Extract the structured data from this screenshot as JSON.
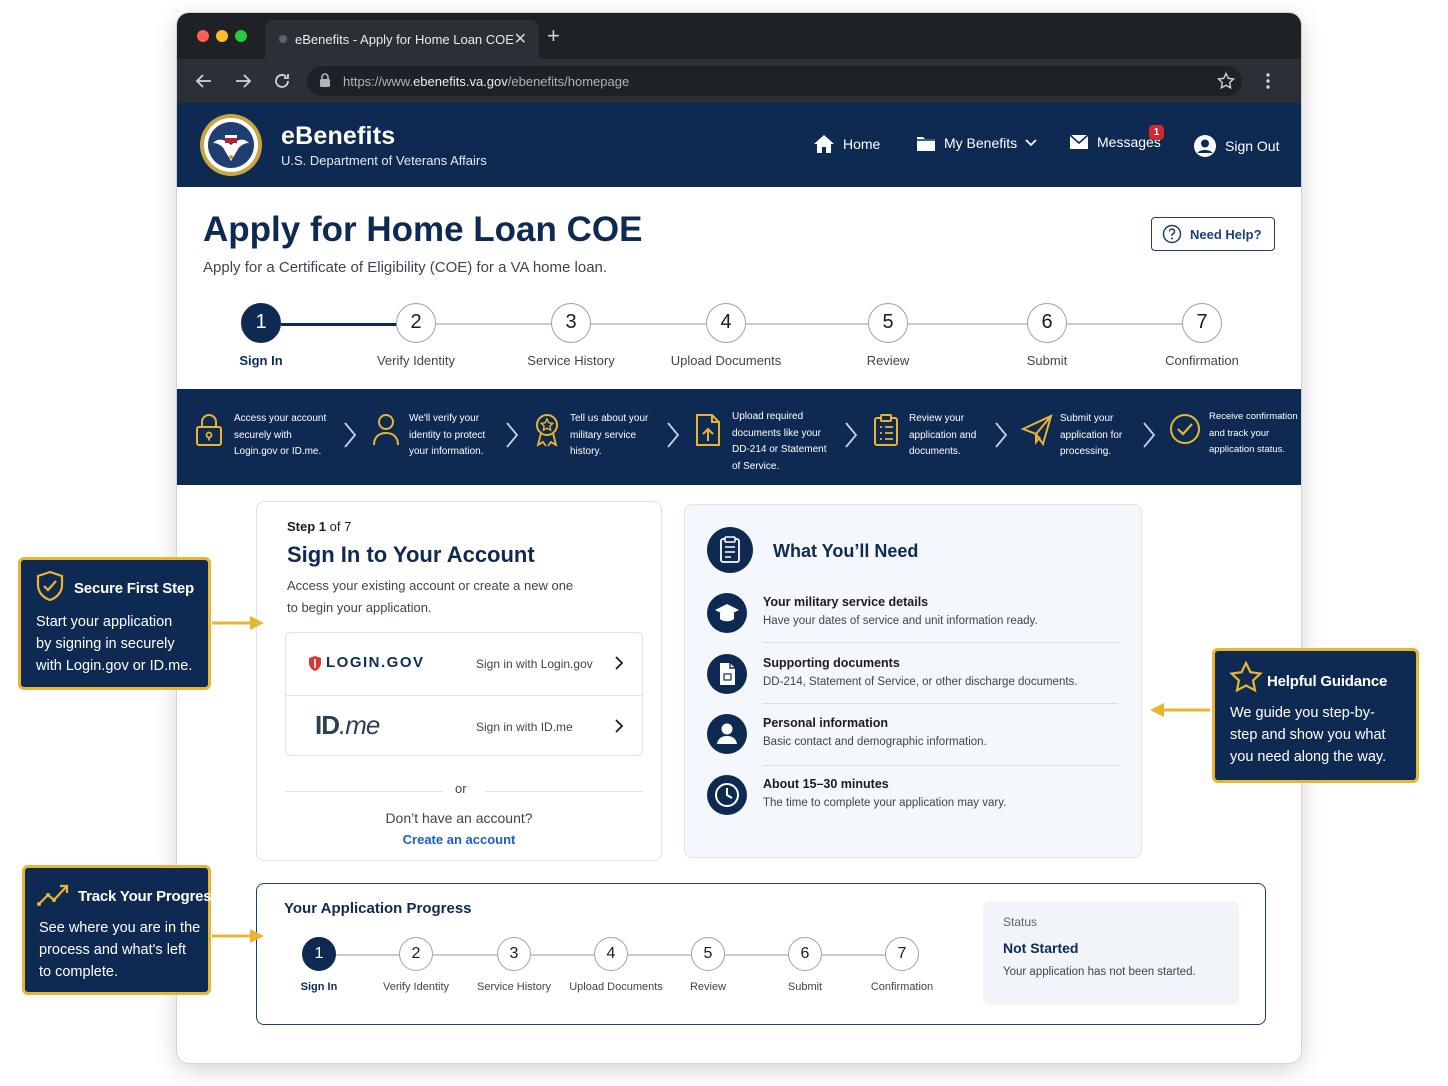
{
  "browser": {
    "tab_title": "eBenefits - Apply for Home Loan COE",
    "url_prefix": "https://www.",
    "url_domain": "ebenefits.va.gov",
    "url_path": "/ebenefits/homepage"
  },
  "header": {
    "brand": "eBenefits",
    "agency": "U.S. Department of Veterans Affairs",
    "nav": {
      "home": "Home",
      "my_benefits": "My Benefits",
      "messages": "Messages",
      "messages_badge": "1",
      "sign_out": "Sign Out"
    }
  },
  "page": {
    "title": "Apply for Home Loan COE",
    "subtitle": "Apply for a Certificate of Eligibility (COE) for a VA home loan.",
    "help_button": "Need Help?"
  },
  "steps": [
    {
      "num": "1",
      "label": "Sign In",
      "active": true
    },
    {
      "num": "2",
      "label": "Verify Identity",
      "active": false
    },
    {
      "num": "3",
      "label": "Service History",
      "active": false
    },
    {
      "num": "4",
      "label": "Upload Documents",
      "active": false
    },
    {
      "num": "5",
      "label": "Review",
      "active": false
    },
    {
      "num": "6",
      "label": "Submit",
      "active": false
    },
    {
      "num": "7",
      "label": "Confirmation",
      "active": false
    }
  ],
  "banner": [
    {
      "icon": "lock-icon",
      "lines": [
        "Access your account",
        "securely with",
        "Login.gov or ID.me."
      ]
    },
    {
      "icon": "person-icon",
      "lines": [
        "We'll verify your",
        "identity to protect",
        "your information."
      ]
    },
    {
      "icon": "medal-icon",
      "lines": [
        "Tell us about your",
        "military service",
        "history."
      ]
    },
    {
      "icon": "upload-document-icon",
      "lines": [
        "Upload required",
        "documents like your",
        "DD-214 or Statement",
        "of Service."
      ]
    },
    {
      "icon": "clipboard-icon",
      "lines": [
        "Review your",
        "application and",
        "documents."
      ]
    },
    {
      "icon": "paper-plane-icon",
      "lines": [
        "Submit your",
        "application for",
        "processing."
      ]
    },
    {
      "icon": "check-circle-icon",
      "lines": [
        "Receive confirmation",
        "and track your",
        "application status."
      ]
    }
  ],
  "signin": {
    "step_word": "Step 1",
    "step_of": "of 7",
    "title": "Sign In to Your Account",
    "desc_line1": "Access your existing account or create a new one",
    "desc_line2": "to begin your application.",
    "login_gov_logo": "LOGIN.GOV",
    "login_gov_action": "Sign in with Login.gov",
    "idme_logo_id": "ID",
    "idme_logo_me": ".me",
    "idme_action": "Sign in with ID.me",
    "or": "or",
    "no_account": "Don’t have an account?",
    "create_link": "Create an account"
  },
  "needs": {
    "title": "What You’ll Need",
    "items": [
      {
        "icon": "graduation-cap-icon",
        "title": "Your military service details",
        "desc": "Have your dates of service and unit information ready."
      },
      {
        "icon": "document-icon",
        "title": "Supporting documents",
        "desc": "DD-214, Statement of Service, or other discharge documents."
      },
      {
        "icon": "user-icon",
        "title": "Personal information",
        "desc": "Basic contact and demographic information."
      },
      {
        "icon": "clock-icon",
        "title": "About 15–30 minutes",
        "desc": "The time to complete your application may vary."
      }
    ]
  },
  "progress": {
    "title": "Your Application Progress",
    "status_label": "Status",
    "status_value": "Not Started",
    "status_desc": "Your application has not been started."
  },
  "callouts": {
    "secure": {
      "title": "Secure First Step",
      "lines": [
        "Start your application",
        "by signing in securely",
        "with Login.gov or ID.me."
      ]
    },
    "track": {
      "title": "Track Your Progress",
      "lines": [
        "See where you are in the",
        "process and what's left",
        "to complete."
      ]
    },
    "guidance": {
      "title": "Helpful Guidance",
      "lines": [
        "We guide you step-by-",
        "step and show you what",
        "you need along the way."
      ]
    }
  },
  "colors": {
    "navy": "#0f2a52",
    "gold": "#e8b531",
    "link": "#1b5fc1",
    "badge_red": "#d3262f"
  }
}
